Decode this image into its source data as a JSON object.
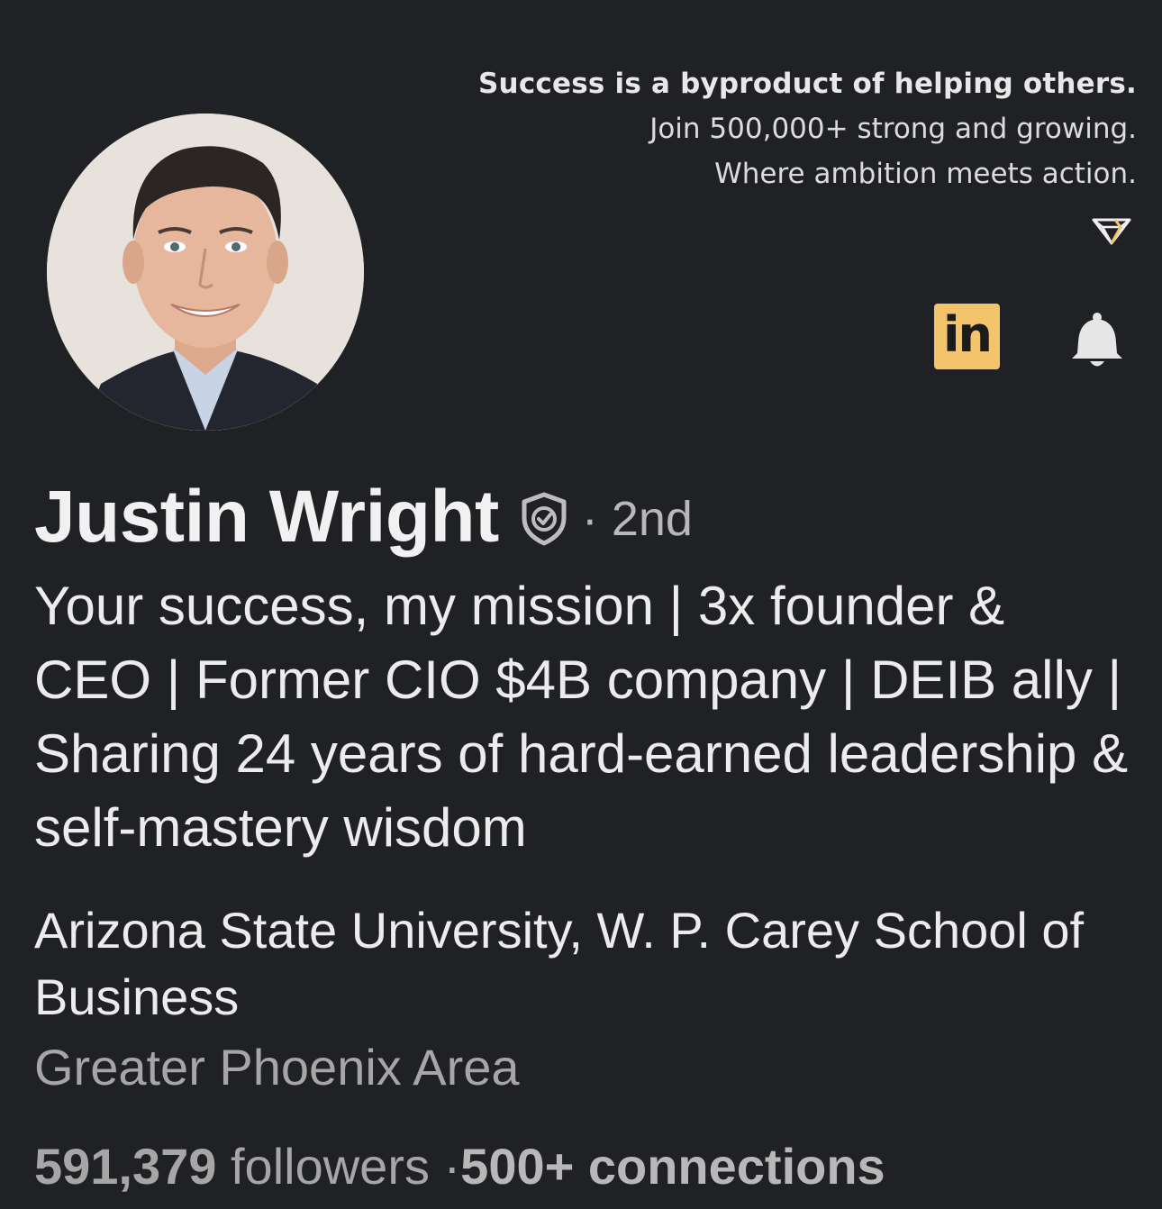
{
  "banner": {
    "tagline_1": "Success is a byproduct of helping others.",
    "tagline_2": "Join 500,000+ strong and growing.",
    "tagline_3": "Where ambition meets action.",
    "logo_icon": "diamond-icon",
    "background_color": "#1f2124",
    "accent_color": "#f3c46b"
  },
  "profile": {
    "avatar_icon": "profile-photo",
    "name": "Justin Wright",
    "verified_icon": "shield-check-icon",
    "degree": "· 2nd",
    "headline": "Your success, my mission | 3x founder & CEO | Former CIO $4B company | DEIB ally | Sharing 24 years of hard-earned leadership & self-mastery wisdom",
    "education": "Arizona State University, W. P. Carey School of Business",
    "location": "Greater Phoenix Area",
    "followers_count": "591,379",
    "followers_label": " followers ·",
    "connections": "500+ connections"
  },
  "actions": {
    "linkedin_label": "in",
    "linkedin_icon": "linkedin-icon",
    "bell_icon": "bell-icon"
  }
}
